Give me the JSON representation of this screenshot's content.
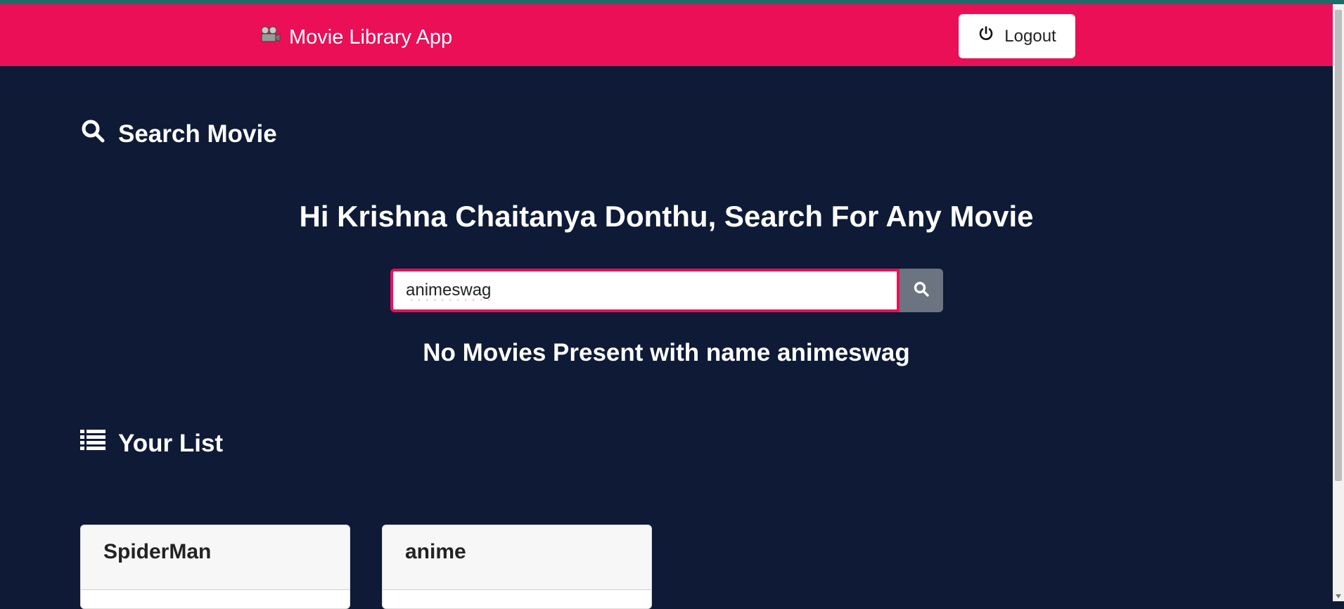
{
  "navbar": {
    "brand_title": "Movie Library App",
    "brand_icon": "movie-camera-icon",
    "logout_label": "Logout",
    "logout_icon": "power-icon",
    "bg_color": "#eb0f58"
  },
  "search_section": {
    "heading": "Search Movie",
    "heading_icon": "search-icon",
    "greeting": "Hi Krishna Chaitanya Donthu, Search For Any Movie",
    "input_value": "animeswag",
    "button_icon": "search-icon",
    "no_results_message": "No Movies Present with name animeswag"
  },
  "list_section": {
    "heading": "Your List",
    "heading_icon": "list-icon",
    "cards": [
      {
        "title": "SpiderMan"
      },
      {
        "title": "anime"
      }
    ]
  }
}
